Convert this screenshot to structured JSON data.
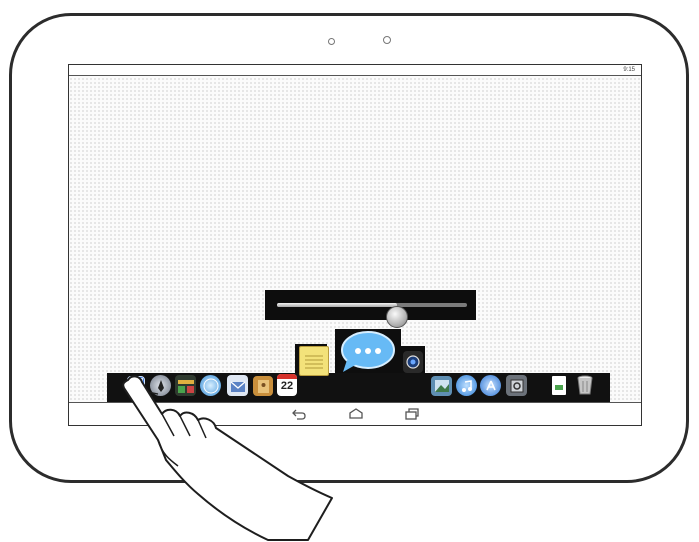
{
  "status_bar": {
    "time": "9:15"
  },
  "volume": {
    "level": 0.63
  },
  "dock": {
    "date_icon_day": "22",
    "items": [
      {
        "name": "finder-icon",
        "color": "#3f78d8"
      },
      {
        "name": "launchpad-icon",
        "color": "#8d96a4"
      },
      {
        "name": "dashboard-icon",
        "color": "#3b8d48"
      },
      {
        "name": "safari-icon",
        "color": "#4aa3e8"
      },
      {
        "name": "mail-icon",
        "color": "#6c8fc8"
      },
      {
        "name": "contacts-icon",
        "color": "#c98f3c"
      },
      {
        "name": "calendar-icon",
        "color": "#ffffff"
      },
      {
        "name": "notes-icon",
        "color": "#f3e27a"
      },
      {
        "name": "messages-icon",
        "color": "#5ab0f2"
      },
      {
        "name": "facetime-icon",
        "color": "#1c1c1c"
      },
      {
        "name": "iphoto-icon",
        "color": "#6aa3c9"
      },
      {
        "name": "itunes-icon",
        "color": "#2e7fd8"
      },
      {
        "name": "app-store-icon",
        "color": "#3d8be0"
      },
      {
        "name": "system-preferences-icon",
        "color": "#9aa0a8"
      },
      {
        "name": "document-icon",
        "color": "#ffffff"
      },
      {
        "name": "trash-icon",
        "color": "#c6c6c6"
      }
    ]
  },
  "navigation": {
    "buttons": [
      {
        "name": "back-button"
      },
      {
        "name": "home-button"
      },
      {
        "name": "recent-apps-button"
      }
    ]
  }
}
